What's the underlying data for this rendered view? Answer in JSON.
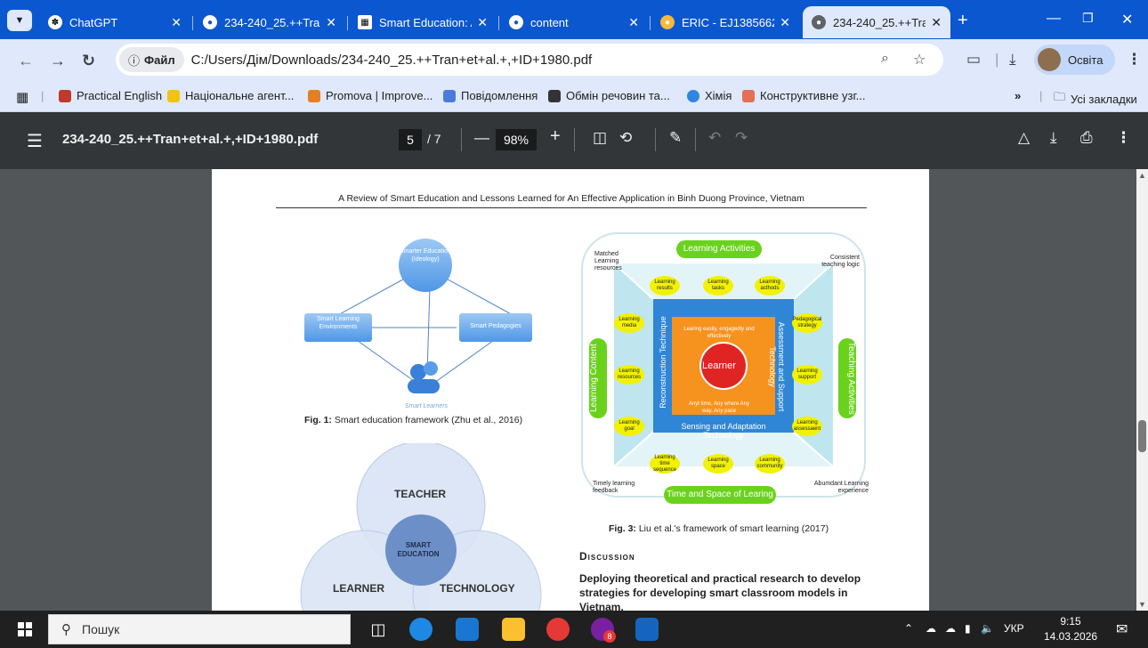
{
  "tabs": [
    {
      "title": "ChatGPT",
      "active": false
    },
    {
      "title": "234-240_25.++Tra",
      "active": false
    },
    {
      "title": "Smart Education: A",
      "active": false
    },
    {
      "title": "content",
      "active": false
    },
    {
      "title": "ERIC - EJ1385662 -",
      "active": false
    },
    {
      "title": "234-240_25.++Tra",
      "active": true
    }
  ],
  "omnibox": {
    "badge": "Файл",
    "url": "C:/Users/Дім/Downloads/234-240_25.++Tran+et+al.+,+ID+1980.pdf"
  },
  "profile": {
    "label": "Освіта"
  },
  "bookmarks": [
    {
      "label": "Practical English",
      "color": "#c0392b"
    },
    {
      "label": "Національне агент...",
      "color": "#f1c40f"
    },
    {
      "label": "Promova | Improve...",
      "color": "#e67e22"
    },
    {
      "label": "Повідомлення",
      "color": "#4a7bd8"
    },
    {
      "label": "Обмін речовин та...",
      "color": "#333333"
    },
    {
      "label": "Хімія",
      "color": "#2e86de"
    },
    {
      "label": "Конструктивне узг...",
      "color": "#e17055"
    }
  ],
  "bookmarks_overflow": "»",
  "all_bookmarks": "Усі закладки",
  "pdf": {
    "filename": "234-240_25.++Tran+et+al.+,+ID+1980.pdf",
    "page_current": "5",
    "page_total": "/ 7",
    "zoom": "98%"
  },
  "document": {
    "running_head": "A Review of Smart Education and Lessons Learned for An Effective Application in Binh Duong Province, Vietnam",
    "fig1": {
      "top_node": "Smarter Education (Ideology)",
      "left_node": "Smart Learning Environments",
      "right_node": "Smart Pedagogies",
      "bottom_node": "Smart Learners",
      "caption_bold": "Fig. 1:",
      "caption_text": "Smart education framework (Zhu et al., 2016)"
    },
    "fig2": {
      "teacher": "TEACHER",
      "learner": "LEARNER",
      "technology": "TECHNOLOGY",
      "center": "SMART EDUCATION"
    },
    "fig3": {
      "top": "Learning Activities",
      "bottom": "Time and Space of Learing",
      "left": "Learning Content",
      "right": "Teaching Activities",
      "corner_tl": "Matched Learning resources",
      "corner_tr": "Consistent teaching logic",
      "corner_bl": "Timely learning feedback",
      "corner_br": "Abumdant Learning experience",
      "yellow_top": [
        "Learning results",
        "Learning tasks",
        "Learning acthods"
      ],
      "yellow_left": [
        "Learning media",
        "Learning resources",
        "Learning goal"
      ],
      "yellow_right": [
        "Pedagogical strategy",
        "Learning support",
        "Learning assessaent"
      ],
      "yellow_bottom": [
        "Learning time sequence",
        "Learning space",
        "Learning community"
      ],
      "blue_left": "Reconstruction Technique",
      "blue_right": "Assessment and Support Technology",
      "blue_bottom": "Sensing and Adaptation Technology",
      "orange_top": "Learing easily, engagedly and effectively",
      "orange_bottom": "Anyt time, Any where Any way, Any pace",
      "center": "Learner",
      "caption_bold": "Fig. 3:",
      "caption_text": "Liu et al.'s framework of smart learning (2017)"
    },
    "section_heading": "Discussion",
    "body_bold": "Deploying theoretical and practical research to develop strategies for developing smart classroom models in Vietnam."
  },
  "taskbar": {
    "search_placeholder": "Пошук",
    "lang": "УКР",
    "time": "9:15",
    "date": "14.03.2026",
    "badge_count": "8"
  }
}
